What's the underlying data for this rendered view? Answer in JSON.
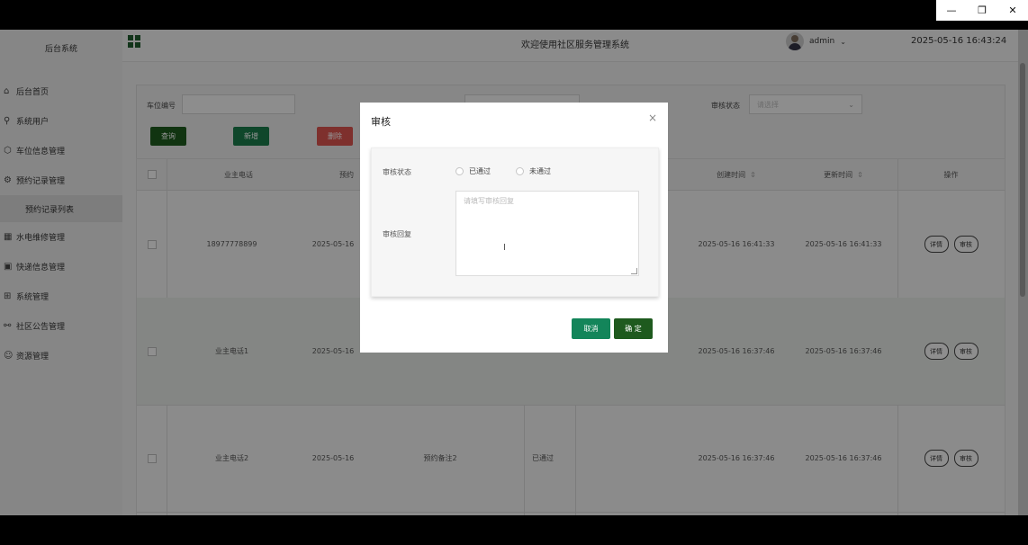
{
  "window": {
    "minimize_icon": "minimize-icon",
    "restore_icon": "restore-icon",
    "close_icon": "close-icon"
  },
  "sidebar": {
    "brand": "后台系统",
    "items": [
      {
        "label": "后台首页",
        "icon": "home-icon"
      },
      {
        "label": "系统用户",
        "icon": "user-icon"
      },
      {
        "label": "车位信息管理",
        "icon": "cube-icon"
      },
      {
        "label": "预约记录管理",
        "icon": "gear-icon",
        "sub": "预约记录列表"
      },
      {
        "label": "水电维修管理",
        "icon": "grid-icon"
      },
      {
        "label": "快递信息管理",
        "icon": "package-icon"
      },
      {
        "label": "系统管理",
        "icon": "apps-icon"
      },
      {
        "label": "社区公告管理",
        "icon": "share-icon"
      },
      {
        "label": "资源管理",
        "icon": "chat-icon"
      }
    ]
  },
  "header": {
    "title": "欢迎使用社区服务管理系统",
    "user": "admin",
    "datetime": "2025-05-16 16:43:24"
  },
  "filter": {
    "parking_label": "车位编号",
    "status_label": "审核状态",
    "status_placeholder": "请选择",
    "buttons": {
      "query": "查询",
      "add": "新增",
      "delete": "删除"
    },
    "colors": {
      "query": "#1e5a1e",
      "add": "#1a7a4a",
      "delete": "#d9534f"
    }
  },
  "table": {
    "headers": {
      "phone": "业主电话",
      "appt": "预约",
      "created": "创建时间",
      "updated": "更新时间",
      "ops": "操作"
    },
    "rows": [
      {
        "phone": "18977778899",
        "date": "2025-05-16",
        "remark": "",
        "status": "",
        "created": "2025-05-16 16:41:33",
        "updated": "2025-05-16 16:41:33"
      },
      {
        "phone": "业主电话1",
        "date": "2025-05-16",
        "remark": "",
        "status": "",
        "created": "2025-05-16 16:37:46",
        "updated": "2025-05-16 16:37:46"
      },
      {
        "phone": "业主电话2",
        "date": "2025-05-16",
        "remark": "预约备注2",
        "status": "已通过",
        "created": "2025-05-16 16:37:46",
        "updated": "2025-05-16 16:37:46"
      }
    ],
    "ops": {
      "detail": "详情",
      "review": "审核"
    }
  },
  "modal": {
    "title": "审核",
    "status_label": "审核状态",
    "options": [
      "已通过",
      "未通过"
    ],
    "reply_label": "审核回复",
    "reply_placeholder": "请填写审核回复",
    "cancel": "取消",
    "confirm": "确 定",
    "colors": {
      "cancel": "#13855a",
      "confirm": "#1e5a1e"
    }
  }
}
